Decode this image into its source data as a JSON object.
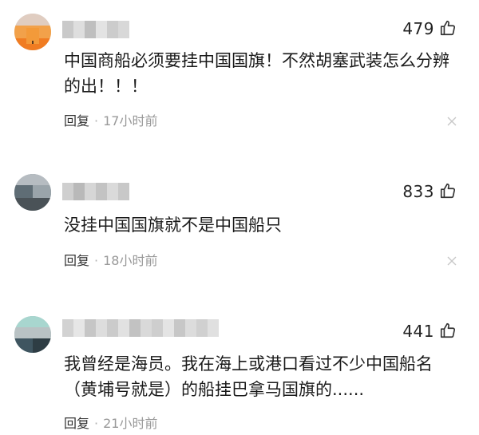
{
  "comments": [
    {
      "likes": "479",
      "text": "中国商船必须要挂中国国旗！不然胡塞武装怎么分辨的出！！！",
      "reply_label": "回复",
      "separator": "·",
      "time": "17小时前",
      "username_blurred": true
    },
    {
      "likes": "833",
      "text": "没挂中国国旗就不是中国船只",
      "reply_label": "回复",
      "separator": "·",
      "time": "18小时前",
      "username_blurred": true
    },
    {
      "likes": "441",
      "text": "我曾经是海员。我在海上或港口看过不少中国船名（黄埔号就是）的船挂巴拿马国旗的......",
      "reply_label": "回复",
      "separator": "·",
      "time": "21小时前",
      "username_blurred": true
    }
  ],
  "icons": {
    "like": "thumbs-up-icon",
    "dismiss": "close-icon"
  },
  "colors": {
    "text": "#1a1a1a",
    "time": "#999999",
    "icon": "#333333",
    "close": "#c8c8c8"
  }
}
